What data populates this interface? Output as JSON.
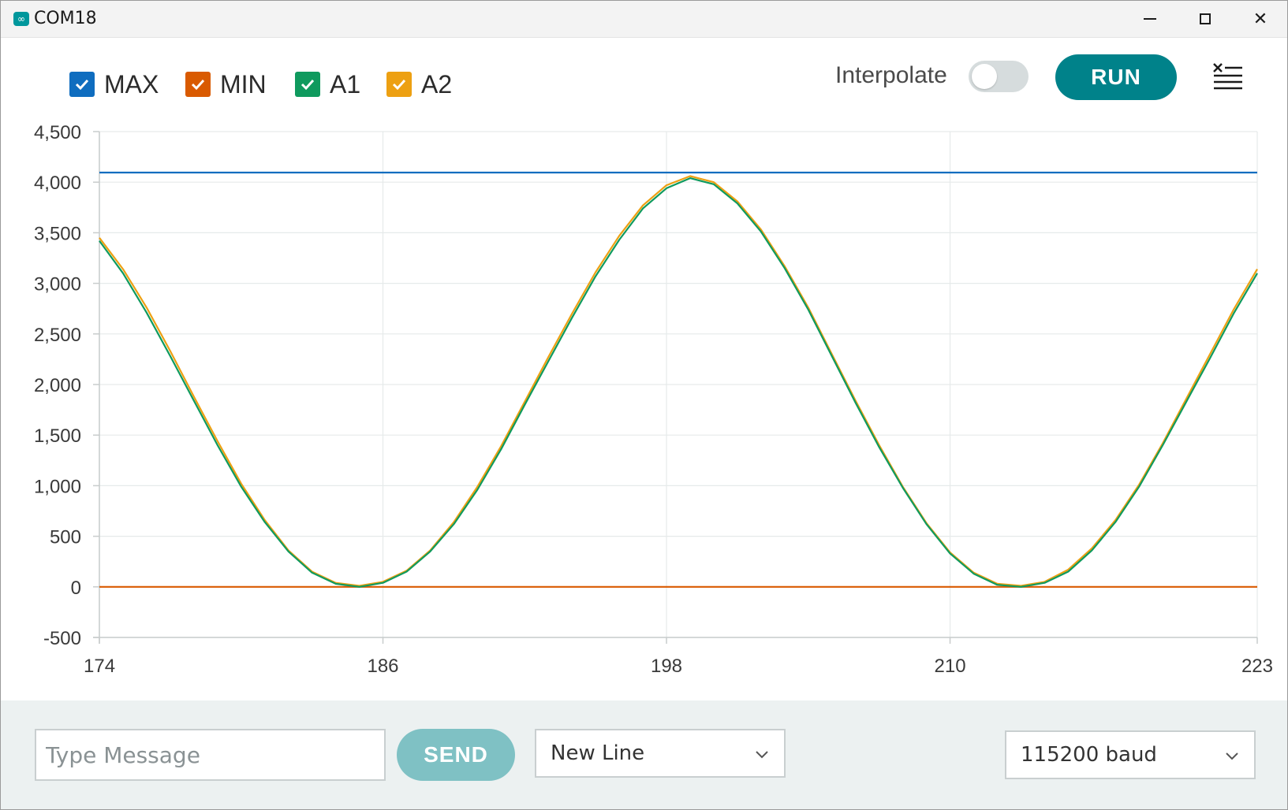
{
  "window": {
    "title": "COM18",
    "app_icon": "arduino-infinity-icon"
  },
  "toolbar": {
    "legend": [
      {
        "label": "MAX",
        "color": "#0f6dbf",
        "checked": true
      },
      {
        "label": "MIN",
        "color": "#d95a00",
        "checked": true
      },
      {
        "label": "A1",
        "color": "#0f9a5e",
        "checked": true
      },
      {
        "label": "A2",
        "color": "#eda012",
        "checked": true
      }
    ],
    "interpolate_label": "Interpolate",
    "interpolate_on": false,
    "run_label": "RUN",
    "clear_icon": "clear-list-icon"
  },
  "chart_data": {
    "type": "line",
    "title": "",
    "xlabel": "",
    "ylabel": "",
    "xlim": [
      174,
      223
    ],
    "ylim": [
      -500,
      4500
    ],
    "x_ticks": [
      174,
      186,
      198,
      210,
      223
    ],
    "y_ticks": [
      4500,
      4000,
      3500,
      3000,
      2500,
      2000,
      1500,
      1000,
      500,
      0,
      -500
    ],
    "y_tick_labels": [
      "4,500",
      "4,000",
      "3,500",
      "3,000",
      "2,500",
      "2,000",
      "1,500",
      "1,000",
      "500",
      "0",
      "-500"
    ],
    "grid": true,
    "series": [
      {
        "name": "MAX",
        "color": "#0f6dbf",
        "x": [
          174,
          223
        ],
        "values": [
          4095,
          4095
        ]
      },
      {
        "name": "MIN",
        "color": "#d95a00",
        "x": [
          174,
          223
        ],
        "values": [
          0,
          0
        ]
      },
      {
        "name": "A2",
        "color": "#eda012",
        "x": [
          174,
          175,
          176,
          177,
          178,
          179,
          180,
          181,
          182,
          183,
          184,
          185,
          186,
          187,
          188,
          189,
          190,
          191,
          192,
          193,
          194,
          195,
          196,
          197,
          198,
          199,
          200,
          201,
          202,
          203,
          204,
          205,
          206,
          207,
          208,
          209,
          210,
          211,
          212,
          213,
          214,
          215,
          216,
          217,
          218,
          219,
          220,
          221,
          222,
          223
        ],
        "values": [
          3450,
          3140,
          2760,
          2330,
          1880,
          1440,
          1020,
          660,
          360,
          150,
          40,
          10,
          50,
          160,
          360,
          640,
          990,
          1390,
          1830,
          2270,
          2700,
          3110,
          3470,
          3770,
          3970,
          4060,
          4000,
          3810,
          3530,
          3170,
          2760,
          2300,
          1840,
          1400,
          990,
          630,
          340,
          140,
          30,
          10,
          50,
          170,
          380,
          660,
          1010,
          1420,
          1860,
          2300,
          2740,
          3140
        ]
      },
      {
        "name": "A1",
        "color": "#0f9a5e",
        "x": [
          174,
          175,
          176,
          177,
          178,
          179,
          180,
          181,
          182,
          183,
          184,
          185,
          186,
          187,
          188,
          189,
          190,
          191,
          192,
          193,
          194,
          195,
          196,
          197,
          198,
          199,
          200,
          201,
          202,
          203,
          204,
          205,
          206,
          207,
          208,
          209,
          210,
          211,
          212,
          213,
          214,
          215,
          216,
          217,
          218,
          219,
          220,
          221,
          222,
          223
        ],
        "values": [
          3420,
          3100,
          2710,
          2280,
          1840,
          1400,
          990,
          640,
          350,
          140,
          30,
          0,
          40,
          150,
          350,
          620,
          960,
          1360,
          1800,
          2230,
          2660,
          3070,
          3430,
          3740,
          3940,
          4040,
          3980,
          3790,
          3510,
          3150,
          2740,
          2280,
          1820,
          1380,
          980,
          620,
          330,
          130,
          20,
          0,
          40,
          150,
          360,
          640,
          990,
          1400,
          1830,
          2260,
          2700,
          3100
        ]
      }
    ]
  },
  "bottom": {
    "message_placeholder": "Type Message",
    "send_label": "SEND",
    "line_ending": "New Line",
    "baud_rate": "115200 baud"
  }
}
